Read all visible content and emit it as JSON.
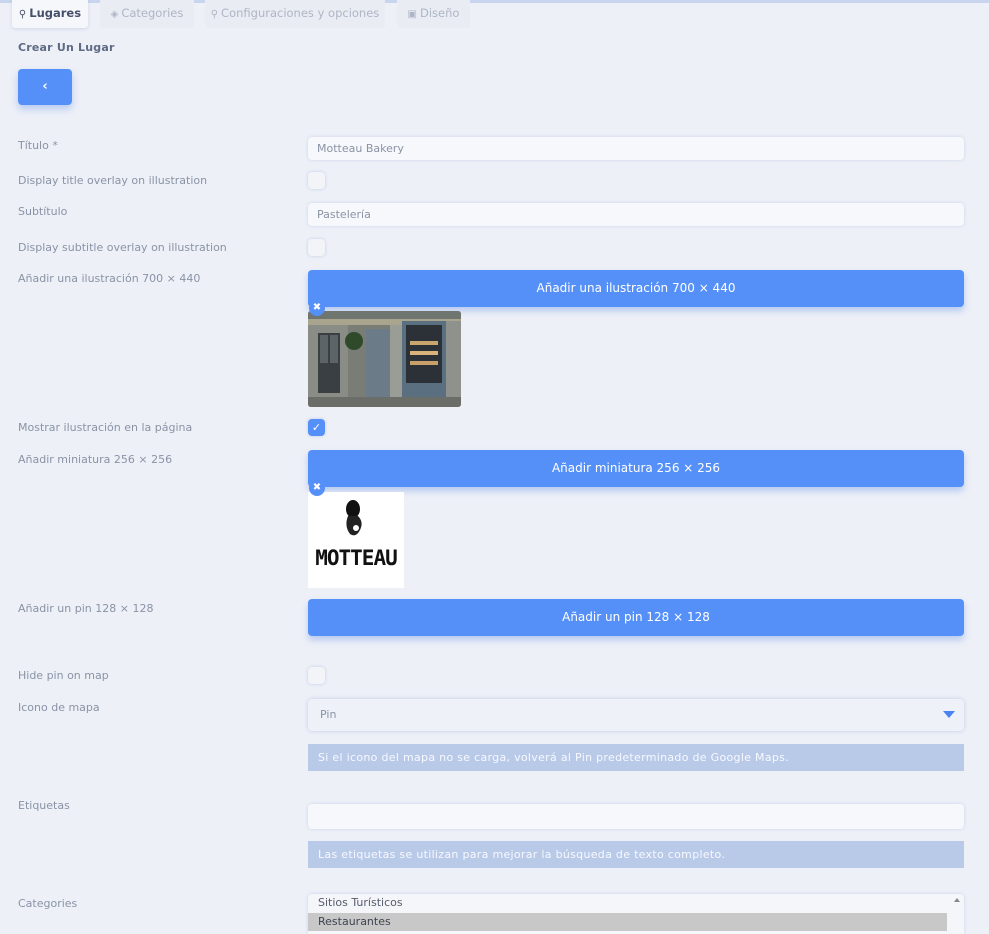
{
  "tabs": [
    {
      "label": "Lugares",
      "icon": "map-marker-icon",
      "active": true
    },
    {
      "label": "Categories",
      "icon": "tags-icon",
      "active": false
    },
    {
      "label": "Configuraciones y opciones",
      "icon": "search-icon",
      "active": false
    },
    {
      "label": "Diseño",
      "icon": "image-icon",
      "active": false
    }
  ],
  "page_title": "Crear Un Lugar",
  "back_button_label": "‹",
  "form": {
    "title": {
      "label": "Título *",
      "value": "Motteau Bakery"
    },
    "title_overlay": {
      "label": "Display title overlay on illustration",
      "checked": false
    },
    "subtitle": {
      "label": "Subtítulo",
      "value": "Pastelería"
    },
    "subtitle_overlay": {
      "label": "Display subtitle overlay on illustration",
      "checked": false
    },
    "illustration": {
      "label": "Añadir una ilustración 700 × 440",
      "button": "Añadir una ilustración 700 × 440",
      "remove": "✖"
    },
    "show_illustration": {
      "label": "Mostrar ilustración en la página",
      "checked": true,
      "check_glyph": "✓"
    },
    "thumbnail": {
      "label": "Añadir miniatura 256 × 256",
      "button": "Añadir miniatura 256 × 256",
      "remove": "✖",
      "logo_text": "MOTTEAU"
    },
    "pin": {
      "label": "Añadir un pin 128 × 128",
      "button": "Añadir un pin 128 × 128"
    },
    "hide_pin": {
      "label": "Hide pin on map",
      "checked": false
    },
    "map_icon": {
      "label": "Icono de mapa",
      "selected": "Pin",
      "help": "Si el icono del mapa no se carga, volverá al Pin predeterminado de Google Maps."
    },
    "tags": {
      "label": "Etiquetas",
      "value": "",
      "help": "Las etiquetas se utilizan para mejorar la búsqueda de texto completo."
    },
    "categories": {
      "label": "Categories",
      "options": [
        "Sitios Turísticos",
        "Restaurantes"
      ],
      "selected_index": 1
    }
  },
  "colors": {
    "accent": "#5590f8",
    "help_bg": "#b9c9e8",
    "background": "#edf0f7"
  }
}
